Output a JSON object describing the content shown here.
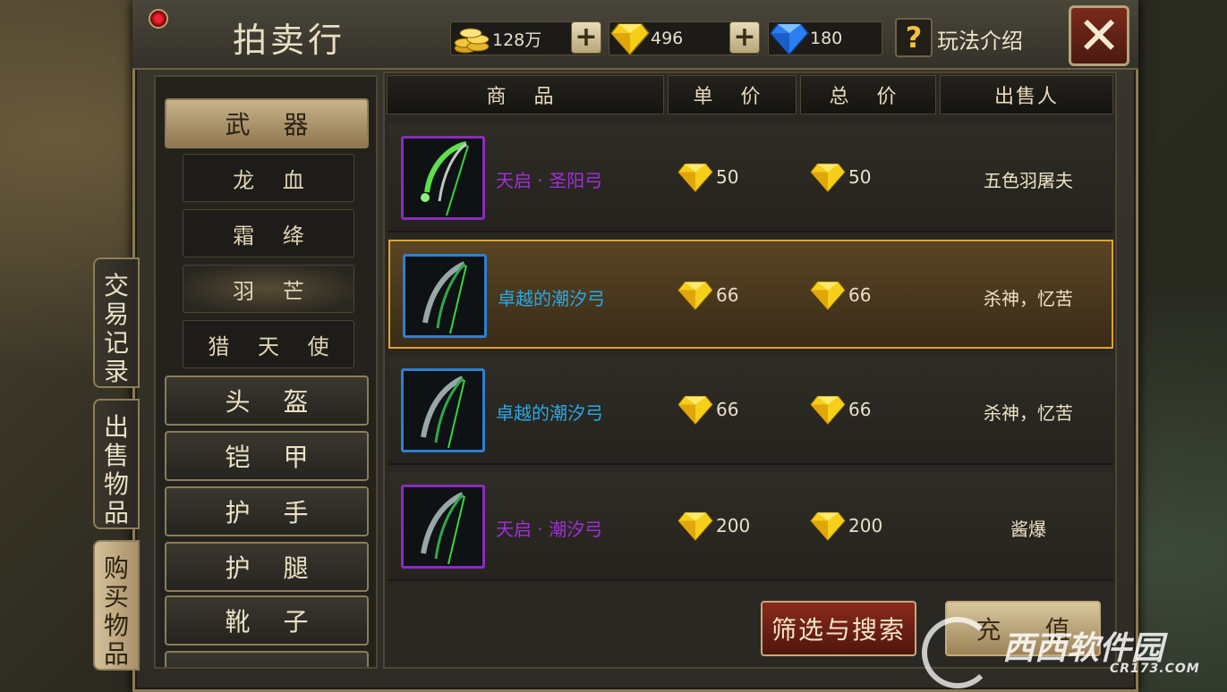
{
  "header": {
    "title": "拍卖行",
    "gold": "128万",
    "gold_gems": "496",
    "blue_gems": "180",
    "help_symbol": "?",
    "help_label": "玩法介绍",
    "close_symbol": "✕"
  },
  "side_tabs": [
    {
      "label": "交易记录"
    },
    {
      "label": "出售物品"
    },
    {
      "label": "购买物品"
    }
  ],
  "categories": {
    "weapon": "武 器",
    "sub": [
      "龙 血",
      "霜 绛",
      "羽 芒",
      "猎 天 使"
    ],
    "helmet": "头 盔",
    "armor": "铠 甲",
    "gloves": "护 手",
    "legs": "护 腿",
    "boots": "靴 子"
  },
  "table": {
    "headers": [
      "商 品",
      "单 价",
      "总 价",
      "出售人"
    ],
    "rows": [
      {
        "name": "天启 · 圣阳弓",
        "unit": "50",
        "total": "50",
        "seller": "五色羽屠夫",
        "rarity": "purple"
      },
      {
        "name": "卓越的潮汐弓",
        "unit": "66",
        "total": "66",
        "seller": "杀神，忆苦",
        "rarity": "blue"
      },
      {
        "name": "卓越的潮汐弓",
        "unit": "66",
        "total": "66",
        "seller": "杀神，忆苦",
        "rarity": "blue"
      },
      {
        "name": "天启 · 潮汐弓",
        "unit": "200",
        "total": "200",
        "seller": "酱爆",
        "rarity": "purple"
      }
    ]
  },
  "actions": {
    "filter": "筛选与搜索",
    "recharge": "充 值"
  },
  "watermark": {
    "text": "西西软件园",
    "sub": "CR173.COM"
  },
  "colors": {
    "purple_text": "#a02fd8",
    "blue_text": "#28a9e6",
    "selected_border": "#e4a22a"
  }
}
